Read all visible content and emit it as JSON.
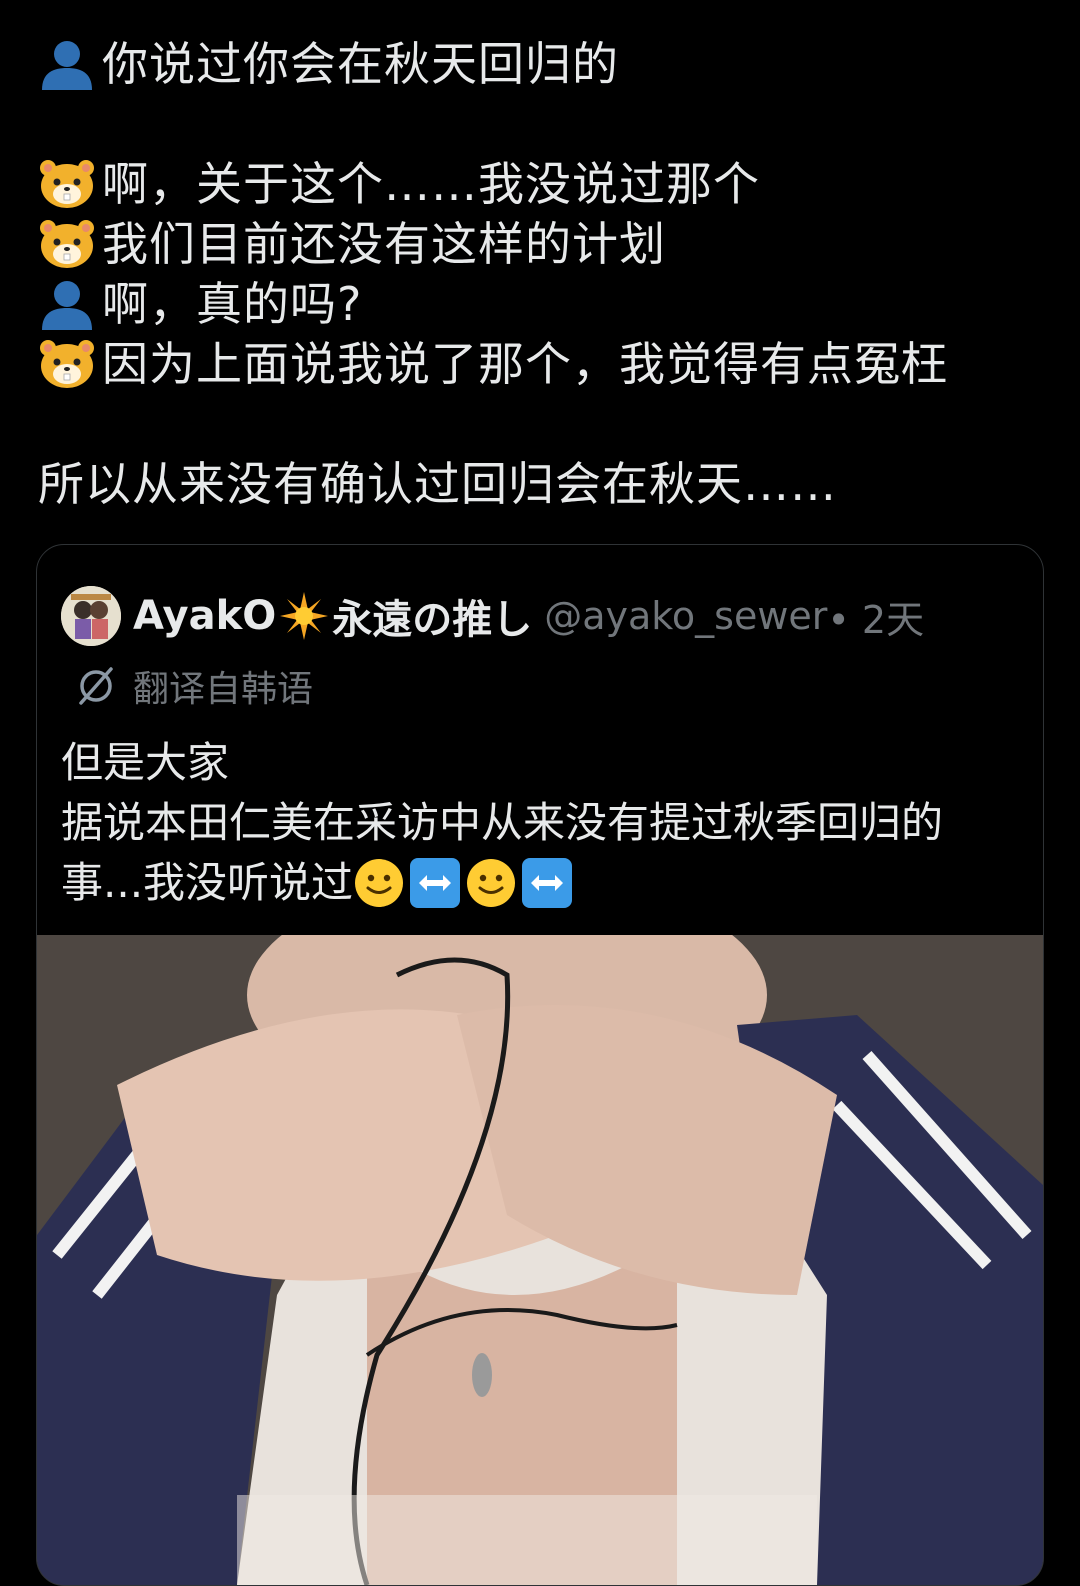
{
  "post": {
    "lines": [
      {
        "speaker": "person-icon",
        "text": "你说过你会在秋天回归的"
      },
      {
        "speaker": "hamster-icon",
        "text": "啊，关于这个……我没说过那个"
      },
      {
        "speaker": "hamster-icon",
        "text": " 我们目前还没有这样的计划"
      },
      {
        "speaker": "person-icon",
        "text": "啊，真的吗?"
      },
      {
        "speaker": "hamster-icon",
        "text": " 因为上面说我说了那个，我觉得有点冤枉"
      }
    ],
    "closing": "所以从来没有确认过回归会在秋天……"
  },
  "quoted": {
    "author_name": "AyakO",
    "author_suffix": "永遠の推し",
    "handle": "@ayako_sewer",
    "time": " • 2天",
    "translate_label": "翻译自韩语",
    "lines": [
      "但是大家",
      "据说本田仁美在采访中从来没有提过秋季回归的",
      "事...我没听说过 "
    ],
    "emoji_sequence": [
      "slightly-smiling-face",
      "left-right-arrow",
      "slightly-smiling-face",
      "left-right-arrow"
    ]
  },
  "colors": {
    "background": "#000000",
    "text": "#e7e9ea",
    "secondary": "#71767b",
    "border": "#2f3336"
  }
}
